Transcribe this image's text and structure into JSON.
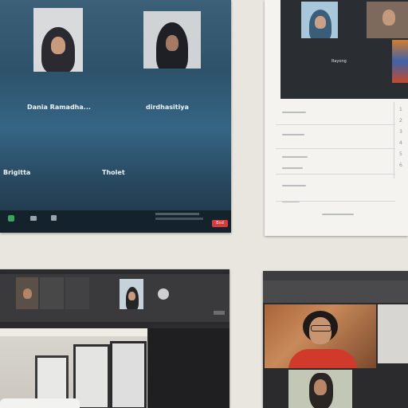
{
  "print1": {
    "tiles": [
      {
        "name": "Dania Ramadha..."
      },
      {
        "name": "dirdhasitiya"
      },
      {
        "name": "Brigitta"
      },
      {
        "name": "Tholet"
      }
    ],
    "toolbar": {
      "end_label": "End"
    }
  },
  "print2": {
    "participant_name": "Rayong",
    "row_numbers": [
      "1",
      "2",
      "3",
      "4",
      "5",
      "6"
    ]
  },
  "colors": {
    "meeting_bg": "#2e4f66",
    "meeting_bg_deep": "#1c3648",
    "end_button": "#d93b3b",
    "paper": "#e9e6e0"
  }
}
